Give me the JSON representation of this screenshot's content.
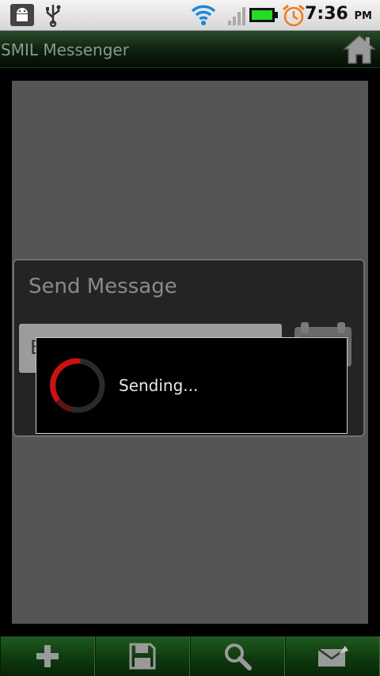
{
  "status_bar": {
    "time": "7:36",
    "ampm": "PM",
    "icons": [
      "android-debug-icon",
      "usb-icon",
      "wifi-icon",
      "signal-icon",
      "battery-icon",
      "alarm-icon"
    ]
  },
  "title_bar": {
    "title": "SMIL Messenger",
    "home_icon": "home-icon"
  },
  "send_dialog": {
    "title": "Send Message",
    "recipient_value": "E",
    "attach_icon": "contacts-icon"
  },
  "progress_dialog": {
    "message": "Sending...",
    "spinner_icon": "spinner-icon"
  },
  "toolbar": {
    "items": [
      {
        "icon": "add-icon"
      },
      {
        "icon": "save-icon"
      },
      {
        "icon": "search-icon"
      },
      {
        "icon": "send-mail-icon"
      }
    ]
  },
  "colors": {
    "accent_green": "#1f5a1f",
    "spinner_red": "#cc1111",
    "battery_green": "#22dd22",
    "alarm_orange": "#f07a1a",
    "wifi_blue": "#1a88d8"
  }
}
